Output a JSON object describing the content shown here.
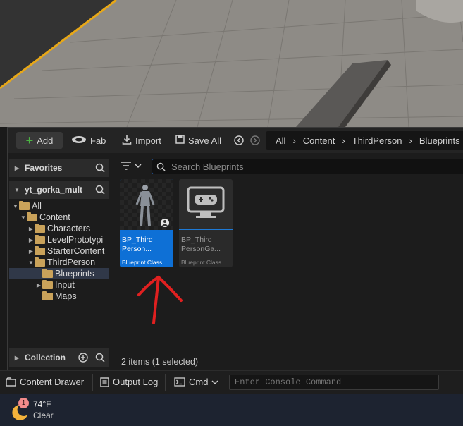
{
  "toolbar": {
    "add_label": "Add",
    "fab_label": "Fab",
    "import_label": "Import",
    "save_all_label": "Save All"
  },
  "breadcrumb": [
    "All",
    "Content",
    "ThirdPerson",
    "Blueprints"
  ],
  "sidebar": {
    "favorites_label": "Favorites",
    "project_label": "yt_gorka_mult",
    "collection_label": "Collection",
    "tree": [
      {
        "label": "All",
        "depth": 0,
        "caret": "open"
      },
      {
        "label": "Content",
        "depth": 1,
        "caret": "open"
      },
      {
        "label": "Characters",
        "depth": 2,
        "caret": "closed"
      },
      {
        "label": "LevelPrototypi",
        "depth": 2,
        "caret": "closed"
      },
      {
        "label": "StarterContent",
        "depth": 2,
        "caret": "closed"
      },
      {
        "label": "ThirdPerson",
        "depth": 2,
        "caret": "open"
      },
      {
        "label": "Blueprints",
        "depth": 3,
        "caret": "none",
        "selected": true
      },
      {
        "label": "Input",
        "depth": 3,
        "caret": "closed"
      },
      {
        "label": "Maps",
        "depth": 3,
        "caret": "none"
      }
    ]
  },
  "search": {
    "placeholder": "Search Blueprints"
  },
  "assets": [
    {
      "name_line1": "BP_Third",
      "name_line2": "Person...",
      "class_label": "Blueprint Class",
      "selected": true
    },
    {
      "name_line1": "BP_Third",
      "name_line2": "PersonGa...",
      "class_label": "Blueprint Class",
      "selected": false
    }
  ],
  "status": {
    "item_count": "2 items (1 selected)"
  },
  "bottom_bar": {
    "content_drawer_label": "Content Drawer",
    "output_log_label": "Output Log",
    "cmd_label": "Cmd",
    "console_placeholder": "Enter Console Command"
  },
  "taskbar": {
    "temperature": "74°F",
    "condition": "Clear",
    "badge_count": "1"
  },
  "colors": {
    "accent_blue": "#0e70d6",
    "folder": "#c9a25a",
    "annotation_red": "#e02020"
  }
}
